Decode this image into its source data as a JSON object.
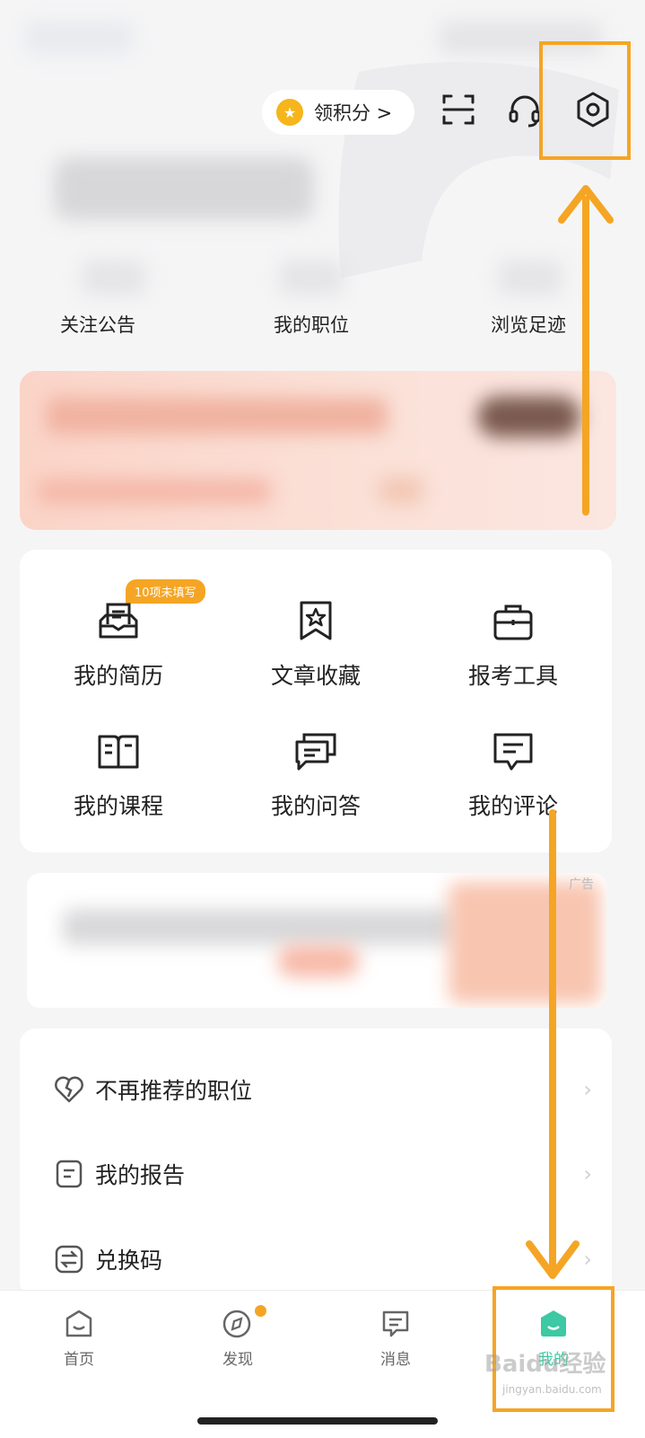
{
  "header": {
    "points_label": "领积分 >",
    "icons": [
      "scan-icon",
      "headset-icon",
      "settings-hex-icon"
    ]
  },
  "stats": [
    {
      "label": "关注公告"
    },
    {
      "label": "我的职位"
    },
    {
      "label": "浏览足迹"
    }
  ],
  "grid": {
    "badge": "10项未填写",
    "items": [
      {
        "label": "我的简历",
        "icon": "resume-icon"
      },
      {
        "label": "文章收藏",
        "icon": "bookmark-star-icon"
      },
      {
        "label": "报考工具",
        "icon": "briefcase-icon"
      },
      {
        "label": "我的课程",
        "icon": "book-icon"
      },
      {
        "label": "我的问答",
        "icon": "qa-icon"
      },
      {
        "label": "我的评论",
        "icon": "comment-icon"
      }
    ]
  },
  "ad_tag": "广告",
  "list": [
    {
      "label": "不再推荐的职位",
      "icon": "broken-heart-icon"
    },
    {
      "label": "我的报告",
      "icon": "report-icon"
    },
    {
      "label": "兑换码",
      "icon": "exchange-icon"
    }
  ],
  "tabbar": [
    {
      "label": "首页",
      "icon": "home-icon"
    },
    {
      "label": "发现",
      "icon": "compass-icon"
    },
    {
      "label": "消息",
      "icon": "message-icon"
    },
    {
      "label": "我的",
      "icon": "profile-icon"
    }
  ],
  "watermark": "Baidu经验",
  "watermark_sub": "jingyan.baidu.com",
  "colors": {
    "accent": "#f5a524",
    "active_tab": "#3cc9a3",
    "vip_bg": "#fbd9cd"
  }
}
